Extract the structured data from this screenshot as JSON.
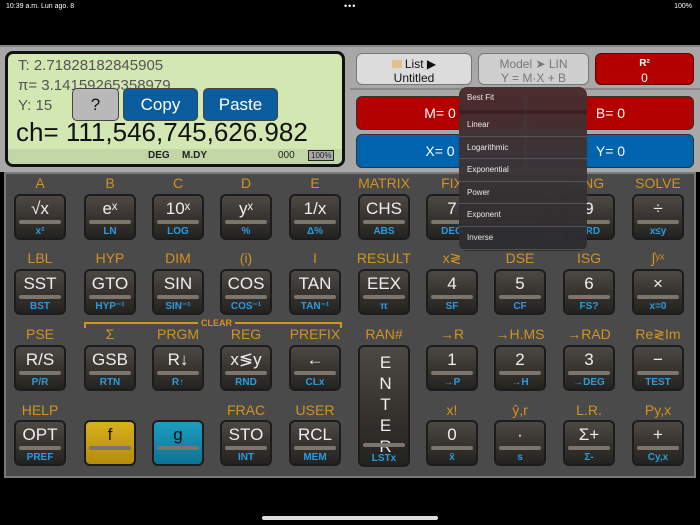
{
  "status": {
    "time": "10:39 a.m.  Lun ago. 8",
    "dots": "•••",
    "battery": "100%"
  },
  "display": {
    "t": "T:  2.71828182845905",
    "z": "π=  3.14159265358979",
    "y": "Y:  15",
    "x": "ch= 111,546,745,626.982",
    "angle": "DEG",
    "date": "M.DY",
    "flags": "000",
    "battery": "100%"
  },
  "popup": {
    "help": "?",
    "copy": "Copy",
    "paste": "Paste"
  },
  "header": {
    "list_label": "List ▶",
    "list_name": "Untitled",
    "model_label": "Model ➤ LIN",
    "model_eq": "Y = M·X + B",
    "r2_label": "R²",
    "r2_value": "0"
  },
  "stats": {
    "m": "M= 0",
    "b": "B= 0",
    "x": "X= 0",
    "y": "Y= 0"
  },
  "menu": {
    "items": [
      "Best Fit",
      "Linear",
      "Logarithmic",
      "Exponential",
      "Power",
      "Exponent",
      "Inverse"
    ]
  },
  "clear_label": "CLEAR",
  "colors": {
    "red": "#b30000",
    "blue": "#0063ad",
    "gold": "#d4921e",
    "sub": "#2a9be0"
  },
  "keys": [
    {
      "top": "A",
      "main": "√x",
      "sub": "x²"
    },
    {
      "top": "B",
      "main": "eˣ",
      "sub": "LN"
    },
    {
      "top": "C",
      "main": "10ˣ",
      "sub": "LOG"
    },
    {
      "top": "D",
      "main": "yˣ",
      "sub": "%"
    },
    {
      "top": "E",
      "main": "1/x",
      "sub": "Δ%"
    },
    {
      "top": "MATRIX",
      "main": "CHS",
      "sub": "ABS"
    },
    {
      "top": "FIX",
      "main": "7",
      "sub": "DEG"
    },
    {
      "top": "",
      "main": "",
      "sub": ""
    },
    {
      "top": "ENG",
      "main": "9",
      "sub": "GRD"
    },
    {
      "top": "SOLVE",
      "main": "÷",
      "sub": "x≤y"
    },
    {
      "top": "LBL",
      "main": "SST",
      "sub": "BST"
    },
    {
      "top": "HYP",
      "main": "GTO",
      "sub": "HYP⁻¹"
    },
    {
      "top": "DIM",
      "main": "SIN",
      "sub": "SIN⁻¹"
    },
    {
      "top": "(i)",
      "main": "COS",
      "sub": "COS⁻¹"
    },
    {
      "top": "I",
      "main": "TAN",
      "sub": "TAN⁻¹"
    },
    {
      "top": "RESULT",
      "main": "EEX",
      "sub": "π"
    },
    {
      "top": "x≷",
      "main": "4",
      "sub": "SF"
    },
    {
      "top": "DSE",
      "main": "5",
      "sub": "CF"
    },
    {
      "top": "ISG",
      "main": "6",
      "sub": "FS?"
    },
    {
      "top": "∫ʸˣ",
      "main": "×",
      "sub": "x=0"
    },
    {
      "top": "PSE",
      "main": "R/S",
      "sub": "P/R"
    },
    {
      "top": "Σ",
      "main": "GSB",
      "sub": "RTN"
    },
    {
      "top": "PRGM",
      "main": "R↓",
      "sub": "R↑"
    },
    {
      "top": "REG",
      "main": "x≶y",
      "sub": "RND"
    },
    {
      "top": "PREFIX",
      "main": "←",
      "sub": "CLx"
    },
    {
      "top": "RAN#",
      "main": "ENTER",
      "sub": "LSTx",
      "kind": "enter"
    },
    {
      "top": "→R",
      "main": "1",
      "sub": "→P"
    },
    {
      "top": "→H.MS",
      "main": "2",
      "sub": "→H"
    },
    {
      "top": "→RAD",
      "main": "3",
      "sub": "→DEG"
    },
    {
      "top": "Re≷Im",
      "main": "−",
      "sub": "TEST"
    },
    {
      "top": "HELP",
      "main": "OPT",
      "sub": "PREF"
    },
    {
      "top": "",
      "main": "f",
      "sub": "",
      "kind": "f"
    },
    {
      "top": "",
      "main": "g",
      "sub": "",
      "kind": "g"
    },
    {
      "top": "FRAC",
      "main": "STO",
      "sub": "INT"
    },
    {
      "top": "USER",
      "main": "RCL",
      "sub": "MEM"
    },
    {
      "skip": true
    },
    {
      "top": "x!",
      "main": "0",
      "sub": "x̄"
    },
    {
      "top": "ŷ,r",
      "main": "·",
      "sub": "s"
    },
    {
      "top": "L.R.",
      "main": "Σ+",
      "sub": "Σ-"
    },
    {
      "top": "Py,x",
      "main": "+",
      "sub": "Cy,x"
    }
  ]
}
